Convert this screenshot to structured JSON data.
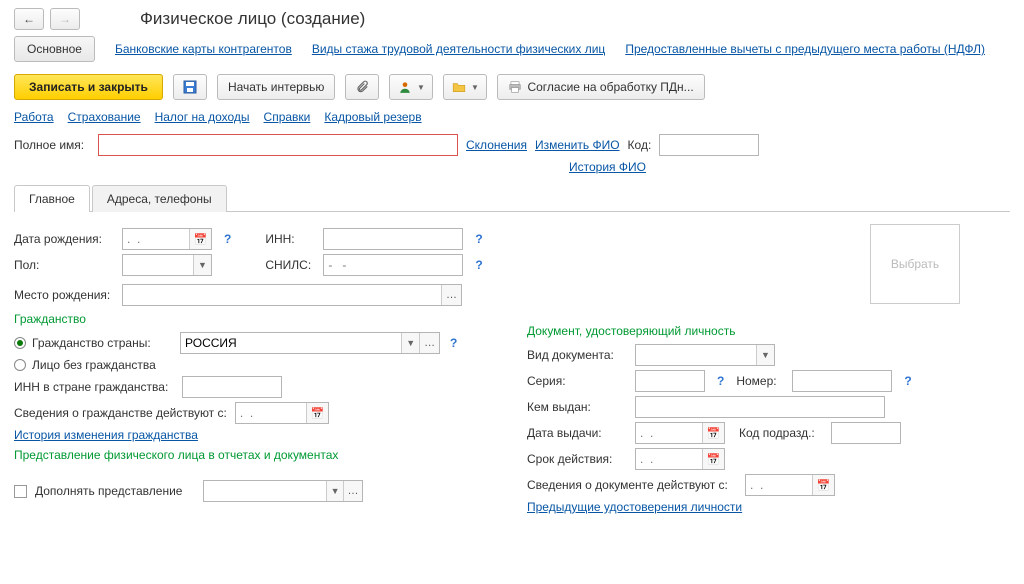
{
  "page_title": "Физическое лицо (создание)",
  "top_tabs": {
    "main": "Основное",
    "bank": "Банковские карты контрагентов",
    "exp": "Виды стажа трудовой деятельности физических лиц",
    "deduct": "Предоставленные вычеты с предыдущего места работы (НДФЛ)"
  },
  "toolbar": {
    "save_close": "Записать и закрыть",
    "interview": "Начать интервью",
    "consent": "Согласие на обработку ПДн..."
  },
  "sublinks": {
    "work": "Работа",
    "insurance": "Страхование",
    "tax": "Налог на доходы",
    "refs": "Справки",
    "reserve": "Кадровый резерв"
  },
  "fullname": {
    "label": "Полное имя:",
    "declension": "Склонения",
    "change": "Изменить ФИО",
    "code_label": "Код:",
    "history": "История ФИО"
  },
  "tabs": {
    "main": "Главное",
    "addr": "Адреса, телефоны"
  },
  "left": {
    "birthdate_label": "Дата рождения:",
    "birthdate_placeholder": ".  .",
    "inn_label": "ИНН:",
    "gender_label": "Пол:",
    "snils_label": "СНИЛС:",
    "snils_placeholder": "-   -",
    "birthplace_label": "Место рождения:",
    "citizenship_title": "Гражданство",
    "cit_country_label": "Гражданство страны:",
    "cit_country_value": "РОССИЯ",
    "stateless_label": "Лицо без гражданства",
    "foreign_inn_label": "ИНН в стране гражданства:",
    "cit_valid_from_label": "Сведения о гражданстве действуют с:",
    "cit_valid_from_placeholder": ".  .",
    "cit_history_link": "История изменения гражданства",
    "repr_title": "Представление физического лица в отчетах и документах",
    "augment_label": "Дополнять представление"
  },
  "right": {
    "photo_placeholder": "Выбрать",
    "doc_title": "Документ, удостоверяющий личность",
    "doc_type_label": "Вид документа:",
    "series_label": "Серия:",
    "number_label": "Номер:",
    "issued_by_label": "Кем выдан:",
    "issue_date_label": "Дата выдачи:",
    "issue_date_placeholder": ".  .",
    "unit_code_label": "Код подразд.:",
    "valid_until_label": "Срок действия:",
    "valid_until_placeholder": ".  .",
    "doc_valid_from_label": "Сведения о документе действуют с:",
    "doc_valid_from_placeholder": ".  .",
    "prev_docs_link": "Предыдущие удостоверения личности"
  }
}
